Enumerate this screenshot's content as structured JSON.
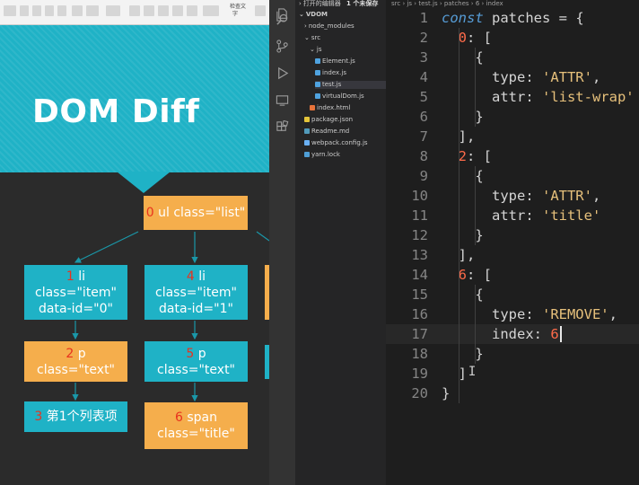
{
  "slide": {
    "ribbon": {
      "labels": [
        "检查文",
        "字"
      ]
    },
    "title": "DOM Diff",
    "nodes": {
      "root": {
        "idx": "0",
        "lines": [
          "ul class=\"list\""
        ]
      },
      "li1": {
        "idx": "1",
        "lines": [
          "li",
          "class=\"item\"",
          "data-id=\"0\""
        ]
      },
      "li4": {
        "idx": "4",
        "lines": [
          "li",
          "class=\"item\"",
          "data-id=\"1\""
        ]
      },
      "p2": {
        "idx": "2",
        "lines": [
          "p",
          "class=\"text\""
        ]
      },
      "p5": {
        "idx": "5",
        "lines": [
          "p",
          "class=\"text\""
        ]
      },
      "text3": {
        "idx": "3",
        "lines": [
          "第1个列表项"
        ]
      },
      "span6": {
        "idx": "6",
        "lines": [
          "span",
          "class=\"title\""
        ]
      }
    },
    "colors": {
      "teal": "#1fb2c6",
      "orange": "#f5ae4c",
      "index_red": "#e8321e",
      "dark_bg": "#2b2b2b"
    }
  },
  "explorer": {
    "open_editors_label": "打开的编辑器",
    "unsaved_badge": "1 个未保存",
    "project": "VDOM",
    "items": [
      {
        "label": "node_modules",
        "type": "folder-closed",
        "depth": 1
      },
      {
        "label": "src",
        "type": "folder-open",
        "depth": 1
      },
      {
        "label": "js",
        "type": "folder-open",
        "depth": 2
      },
      {
        "label": "Element.js",
        "type": "js",
        "depth": 3
      },
      {
        "label": "index.js",
        "type": "js",
        "depth": 3
      },
      {
        "label": "test.js",
        "type": "js",
        "depth": 3,
        "active": true
      },
      {
        "label": "virtualDom.js",
        "type": "js",
        "depth": 3
      },
      {
        "label": "index.html",
        "type": "html",
        "depth": 2
      },
      {
        "label": "package.json",
        "type": "json",
        "depth": 1
      },
      {
        "label": "Readme.md",
        "type": "md",
        "depth": 1
      },
      {
        "label": "webpack.config.js",
        "type": "webpack",
        "depth": 1
      },
      {
        "label": "yarn.lock",
        "type": "yarn",
        "depth": 1
      }
    ]
  },
  "editor": {
    "breadcrumb": [
      "src",
      "js",
      "test.js",
      "patches",
      "6",
      "index"
    ],
    "cursor_line": 17,
    "lines": [
      {
        "n": "1",
        "tokens": [
          {
            "t": "const",
            "c": "kw"
          },
          {
            "t": " patches = {",
            "c": "plain"
          }
        ]
      },
      {
        "n": "2",
        "tokens": [
          {
            "t": "  ",
            "c": "plain"
          },
          {
            "t": "0",
            "c": "num"
          },
          {
            "t": ": [",
            "c": "plain"
          }
        ]
      },
      {
        "n": "3",
        "tokens": [
          {
            "t": "    {",
            "c": "plain"
          }
        ]
      },
      {
        "n": "4",
        "tokens": [
          {
            "t": "      type: ",
            "c": "plain"
          },
          {
            "t": "'ATTR'",
            "c": "str"
          },
          {
            "t": ",",
            "c": "plain"
          }
        ]
      },
      {
        "n": "5",
        "tokens": [
          {
            "t": "      attr: ",
            "c": "plain"
          },
          {
            "t": "'list-wrap'",
            "c": "str"
          }
        ]
      },
      {
        "n": "6",
        "tokens": [
          {
            "t": "    }",
            "c": "plain"
          }
        ]
      },
      {
        "n": "7",
        "tokens": [
          {
            "t": "  ],",
            "c": "plain"
          }
        ]
      },
      {
        "n": "8",
        "tokens": [
          {
            "t": "  ",
            "c": "plain"
          },
          {
            "t": "2",
            "c": "num"
          },
          {
            "t": ": [",
            "c": "plain"
          }
        ]
      },
      {
        "n": "9",
        "tokens": [
          {
            "t": "    {",
            "c": "plain"
          }
        ]
      },
      {
        "n": "10",
        "tokens": [
          {
            "t": "      type: ",
            "c": "plain"
          },
          {
            "t": "'ATTR'",
            "c": "str"
          },
          {
            "t": ",",
            "c": "plain"
          }
        ]
      },
      {
        "n": "11",
        "tokens": [
          {
            "t": "      attr: ",
            "c": "plain"
          },
          {
            "t": "'title'",
            "c": "str"
          }
        ]
      },
      {
        "n": "12",
        "tokens": [
          {
            "t": "    }",
            "c": "plain"
          }
        ]
      },
      {
        "n": "13",
        "tokens": [
          {
            "t": "  ],",
            "c": "plain"
          }
        ]
      },
      {
        "n": "14",
        "tokens": [
          {
            "t": "  ",
            "c": "plain"
          },
          {
            "t": "6",
            "c": "num"
          },
          {
            "t": ": [",
            "c": "plain"
          }
        ]
      },
      {
        "n": "15",
        "tokens": [
          {
            "t": "    {",
            "c": "plain"
          }
        ]
      },
      {
        "n": "16",
        "tokens": [
          {
            "t": "      type: ",
            "c": "plain"
          },
          {
            "t": "'REMOVE'",
            "c": "str"
          },
          {
            "t": ",",
            "c": "plain"
          }
        ]
      },
      {
        "n": "17",
        "tokens": [
          {
            "t": "      index: ",
            "c": "plain"
          },
          {
            "t": "6",
            "c": "num"
          }
        ]
      },
      {
        "n": "18",
        "tokens": [
          {
            "t": "    }",
            "c": "plain"
          }
        ]
      },
      {
        "n": "19",
        "tokens": [
          {
            "t": "  ]",
            "c": "plain"
          }
        ]
      },
      {
        "n": "20",
        "tokens": [
          {
            "t": "}",
            "c": "plain"
          }
        ]
      }
    ],
    "colors": {
      "kw": "#569cd6",
      "num": "#ff6b4a",
      "str": "#e6c07b",
      "plain": "#d4d4d4",
      "gutter": "#858585"
    }
  }
}
